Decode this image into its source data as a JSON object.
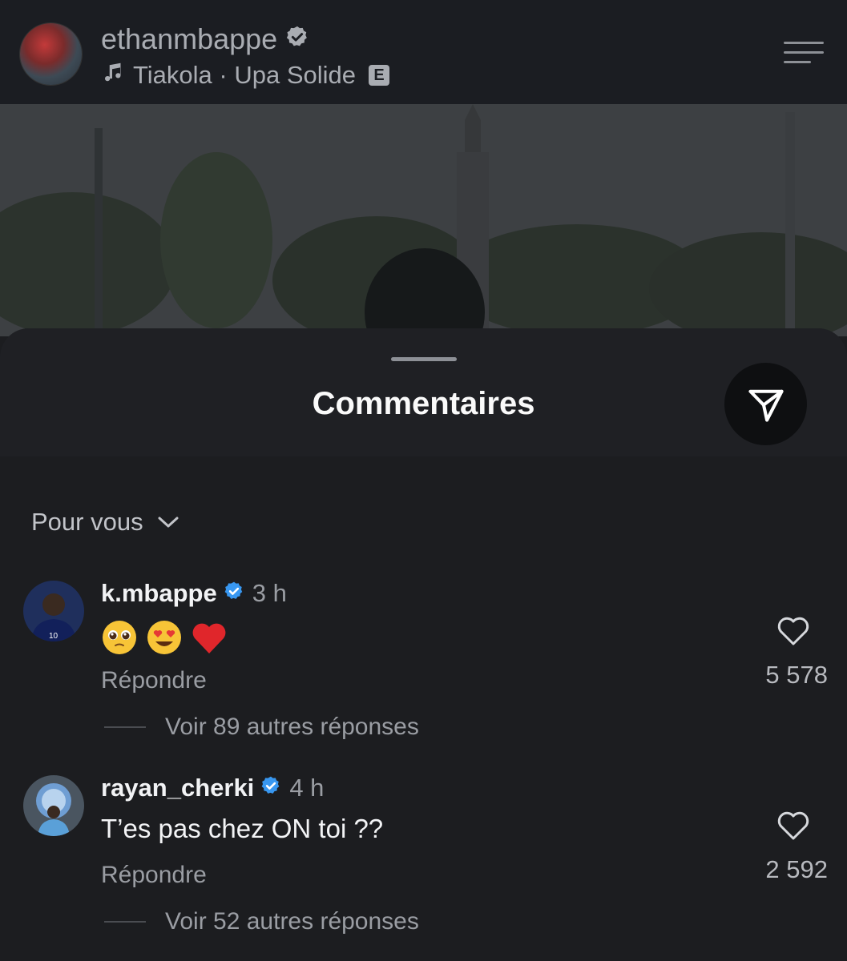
{
  "header": {
    "username": "ethanmbappe",
    "music_label": "Tiakola · Upa Solide",
    "explicit_badge": "E"
  },
  "sheet": {
    "title": "Commentaires"
  },
  "sort": {
    "label": "Pour vous"
  },
  "comments": [
    {
      "username": "k.mbappe",
      "time": "3 h",
      "text": "",
      "emojis": [
        "🥺",
        "😍",
        "❤️"
      ],
      "reply_label": "Répondre",
      "more_replies": "Voir 89 autres réponses",
      "likes": "5 578"
    },
    {
      "username": "rayan_cherki",
      "time": "4 h",
      "text": "T’es pas chez ON toi ??",
      "emojis": [],
      "reply_label": "Répondre",
      "more_replies": "Voir 52 autres réponses",
      "likes": "2 592"
    }
  ],
  "colors": {
    "background": "#1c1d20",
    "verified": "#3897f0",
    "muted_text": "#9a9da3"
  }
}
